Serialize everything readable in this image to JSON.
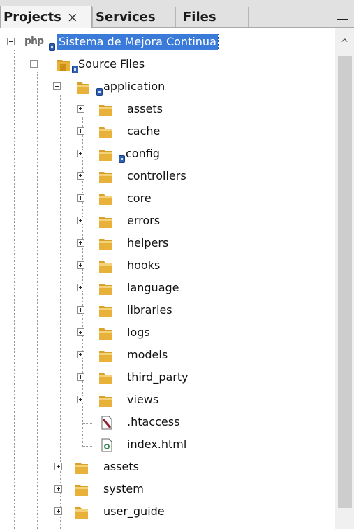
{
  "tabs": {
    "projects": "Projects",
    "services": "Services",
    "files": "Files",
    "close_glyph": "×"
  },
  "tree": {
    "root": {
      "icon_text": "php",
      "label": "Sistema de Mejora Continua"
    },
    "source_files": "Source Files",
    "application": "application",
    "app_children": [
      "assets",
      "cache",
      "config",
      "controllers",
      "core",
      "errors",
      "helpers",
      "hooks",
      "language",
      "libraries",
      "logs",
      "models",
      "third_party",
      "views"
    ],
    "app_files": [
      ".htaccess",
      "index.html"
    ],
    "top_folders": [
      "assets",
      "system",
      "user_guide"
    ]
  },
  "scrollbar": {
    "up_glyph": "^"
  },
  "colors": {
    "selection": "#3a7ad9",
    "folder": "#e8b23a",
    "badge": "#2f5fb0"
  },
  "icons": {
    "folder": "folder-icon",
    "source": "source-files-icon",
    "file_htaccess": "htaccess-file-icon",
    "file_html": "html-file-icon",
    "badge": "version-badge-icon"
  }
}
